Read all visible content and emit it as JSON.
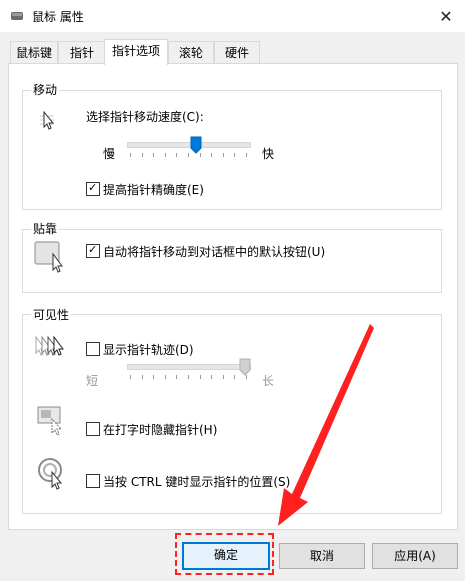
{
  "window": {
    "title": "鼠标 属性",
    "close_glyph": "✕"
  },
  "tabs": [
    {
      "label": "鼠标键",
      "active": false
    },
    {
      "label": "指针",
      "active": false
    },
    {
      "label": "指针选项",
      "active": true
    },
    {
      "label": "滚轮",
      "active": false
    },
    {
      "label": "硬件",
      "active": false
    }
  ],
  "motion": {
    "group_label": "移动",
    "speed_label": "选择指针移动速度(C):",
    "slow_label": "慢",
    "fast_label": "快",
    "speed_fraction": 0.56,
    "enhance_label": "提高指针精确度(E)",
    "enhance_checked": true
  },
  "snap": {
    "group_label": "贴靠",
    "snap_label": "自动将指针移动到对话框中的默认按钮(U)",
    "snap_checked": true
  },
  "visibility": {
    "group_label": "可见性",
    "trails_label": "显示指针轨迹(D)",
    "trails_checked": false,
    "short_label": "短",
    "long_label": "长",
    "trails_fraction": 1.0,
    "hide_label": "在打字时隐藏指针(H)",
    "hide_checked": false,
    "ctrl_label": "当按 CTRL 键时显示指针的位置(S)",
    "ctrl_checked": false
  },
  "buttons": {
    "ok": "确定",
    "cancel": "取消",
    "apply": "应用(A)"
  },
  "annotation": {
    "color": "#ff2020"
  }
}
